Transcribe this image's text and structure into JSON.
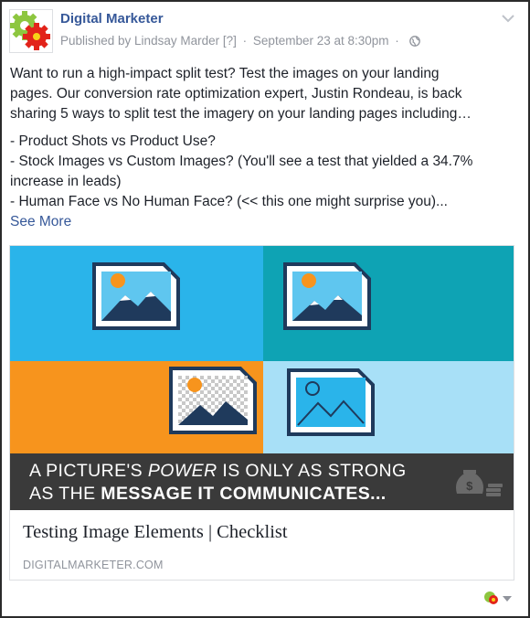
{
  "post": {
    "page_name": "Digital Marketer",
    "published_by": "Published by Lindsay Marder",
    "help_marker": "[?]",
    "separator": "·",
    "timestamp": "September 23 at 8:30pm",
    "privacy_icon": "globe-icon",
    "menu_icon": "chevron-down-icon"
  },
  "body": {
    "paragraph1": [
      "Want to run a high-impact split test? Test the images on your landing",
      "pages. Our conversion rate optimization expert, Justin Rondeau, is back",
      "sharing 5 ways to split test the imagery on your landing pages including…"
    ],
    "list": [
      "- Product Shots vs Product Use?",
      "- Stock Images vs Custom Images? (You'll see a test that yielded a 34.7%",
      "increase in leads)",
      "- Human Face vs No Human Face? (<< this one might surprise you)..."
    ],
    "see_more": "See More"
  },
  "card": {
    "banner": {
      "part1": "A PICTURE'S ",
      "part2": "POWER",
      "part3": " IS ONLY AS STRONG",
      "part4": "AS THE ",
      "part5": "MESSAGE IT COMMUNICATES..."
    },
    "title": "Testing Image Elements | Checklist",
    "domain": "DIGITALMARKETER.COM",
    "colors": {
      "q1": "#2ab4ea",
      "q2": "#0ea3b4",
      "q3": "#f7941d",
      "q4": "#a8e0f7",
      "banner": "#3a3a3a"
    }
  },
  "footer": {
    "reaction_icon": "page-avatar-icon",
    "caret_icon": "caret-down-icon"
  }
}
